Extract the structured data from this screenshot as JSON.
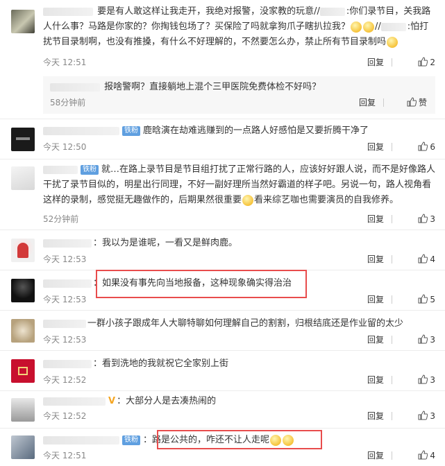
{
  "comments": [
    {
      "text_a": "要是有人敢这样让我走开，我绝对报警，没家教的玩意//",
      "text_b": ":你们录节目，关我路人什么事？马路是你家的？你掏钱包场了？买保险了吗就拿狗爪子瞎扒拉我？",
      "text_c": "//",
      "text_d": ":怕打扰节目录制啊，也没有推搡，有什么不好理解的，不然要怎么办，禁止所有节目录制吗",
      "time": "今天 12:51",
      "reply": "回复",
      "likes": "2",
      "sub": {
        "text": "报啥警啊？直接躺地上混个三甲医院免费体检不好吗？",
        "time": "58分钟前",
        "reply": "回复",
        "likes": "赞"
      }
    },
    {
      "badge": "铁粉",
      "text": "鹿晗演在劫难逃赚到的一点路人好感怕是又要折腾干净了",
      "time": "今天 12:50",
      "reply": "回复",
      "likes": "6"
    },
    {
      "badge": "铁粉",
      "text": "就…在路上录节目是节目组打扰了正常行路的人，应该好好跟人说，而不是好像路人干扰了录节目似的，明星出行同理，不好一副好理所当然好霸道的样子吧。另说一句，路人视角看这样的录制，感觉挺无趣做作的，后期果然很重要",
      "text_tail": "看来综艺咖也需要演员的自我修养。",
      "time": "52分钟前",
      "reply": "回复",
      "likes": "3"
    },
    {
      "text": "：我以为是谁呢，一看又是鲜肉鹿。",
      "time": "今天 12:53",
      "reply": "回复",
      "likes": "4"
    },
    {
      "text": "如果没有事先向当地报备，这种现象确实得治治",
      "time": "今天 12:53",
      "reply": "回复",
      "likes": "5"
    },
    {
      "text": "一群小孩子跟成年人大聊特聊如何理解自己的割割，归根结底还是作业留的太少",
      "time": "今天 12:53",
      "reply": "回复",
      "likes": "3"
    },
    {
      "text": "：看到洗地的我就祝它全家别上街",
      "time": "今天 12:52",
      "reply": "回复",
      "likes": "3"
    },
    {
      "vmark": "V",
      "text": "：大部分人是去凑热闹的",
      "time": "今天 12:52",
      "reply": "回复",
      "likes": "3"
    },
    {
      "badge": "铁粉",
      "text": "路是公共的，咋还不让人走呢",
      "time": "今天 12:51",
      "reply": "回复",
      "likes": "4"
    }
  ]
}
